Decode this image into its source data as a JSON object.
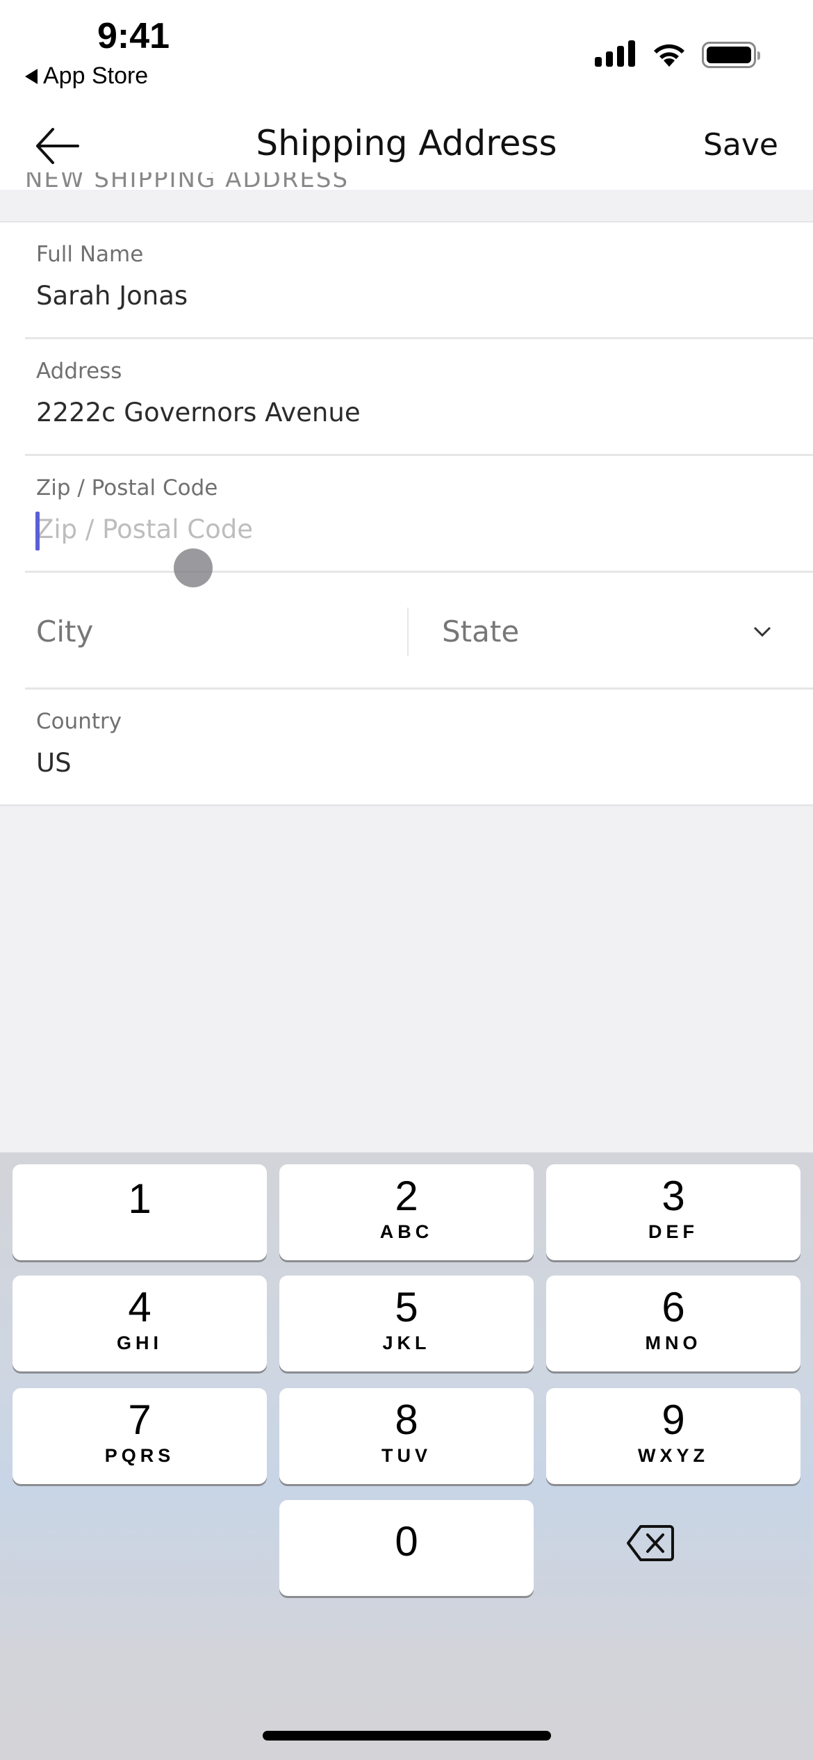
{
  "status_bar": {
    "time": "9:41",
    "back_app": "App Store",
    "icons": [
      "cellular-signal-icon",
      "wifi-icon",
      "battery-icon"
    ]
  },
  "nav": {
    "title": "Shipping Address",
    "save_label": "Save",
    "back_icon": "arrow-left-icon"
  },
  "section_header": "NEW SHIPPING ADDRESS",
  "form": {
    "full_name": {
      "label": "Full Name",
      "value": "Sarah Jonas"
    },
    "address": {
      "label": "Address",
      "value": "2222c Governors Avenue"
    },
    "zip": {
      "label": "Zip / Postal Code",
      "placeholder": "Zip / Postal Code",
      "value": ""
    },
    "city": {
      "placeholder": "City"
    },
    "state": {
      "placeholder": "State",
      "icon": "chevron-down-icon"
    },
    "country": {
      "label": "Country",
      "value": "US"
    }
  },
  "colors": {
    "cursor": "#5a5fd6"
  },
  "keyboard": {
    "keys": [
      {
        "digit": "1",
        "letters": ""
      },
      {
        "digit": "2",
        "letters": "ABC"
      },
      {
        "digit": "3",
        "letters": "DEF"
      },
      {
        "digit": "4",
        "letters": "GHI"
      },
      {
        "digit": "5",
        "letters": "JKL"
      },
      {
        "digit": "6",
        "letters": "MNO"
      },
      {
        "digit": "7",
        "letters": "PQRS"
      },
      {
        "digit": "8",
        "letters": "TUV"
      },
      {
        "digit": "9",
        "letters": "WXYZ"
      },
      {
        "digit": "0",
        "letters": ""
      }
    ],
    "delete_icon": "backspace-icon"
  }
}
